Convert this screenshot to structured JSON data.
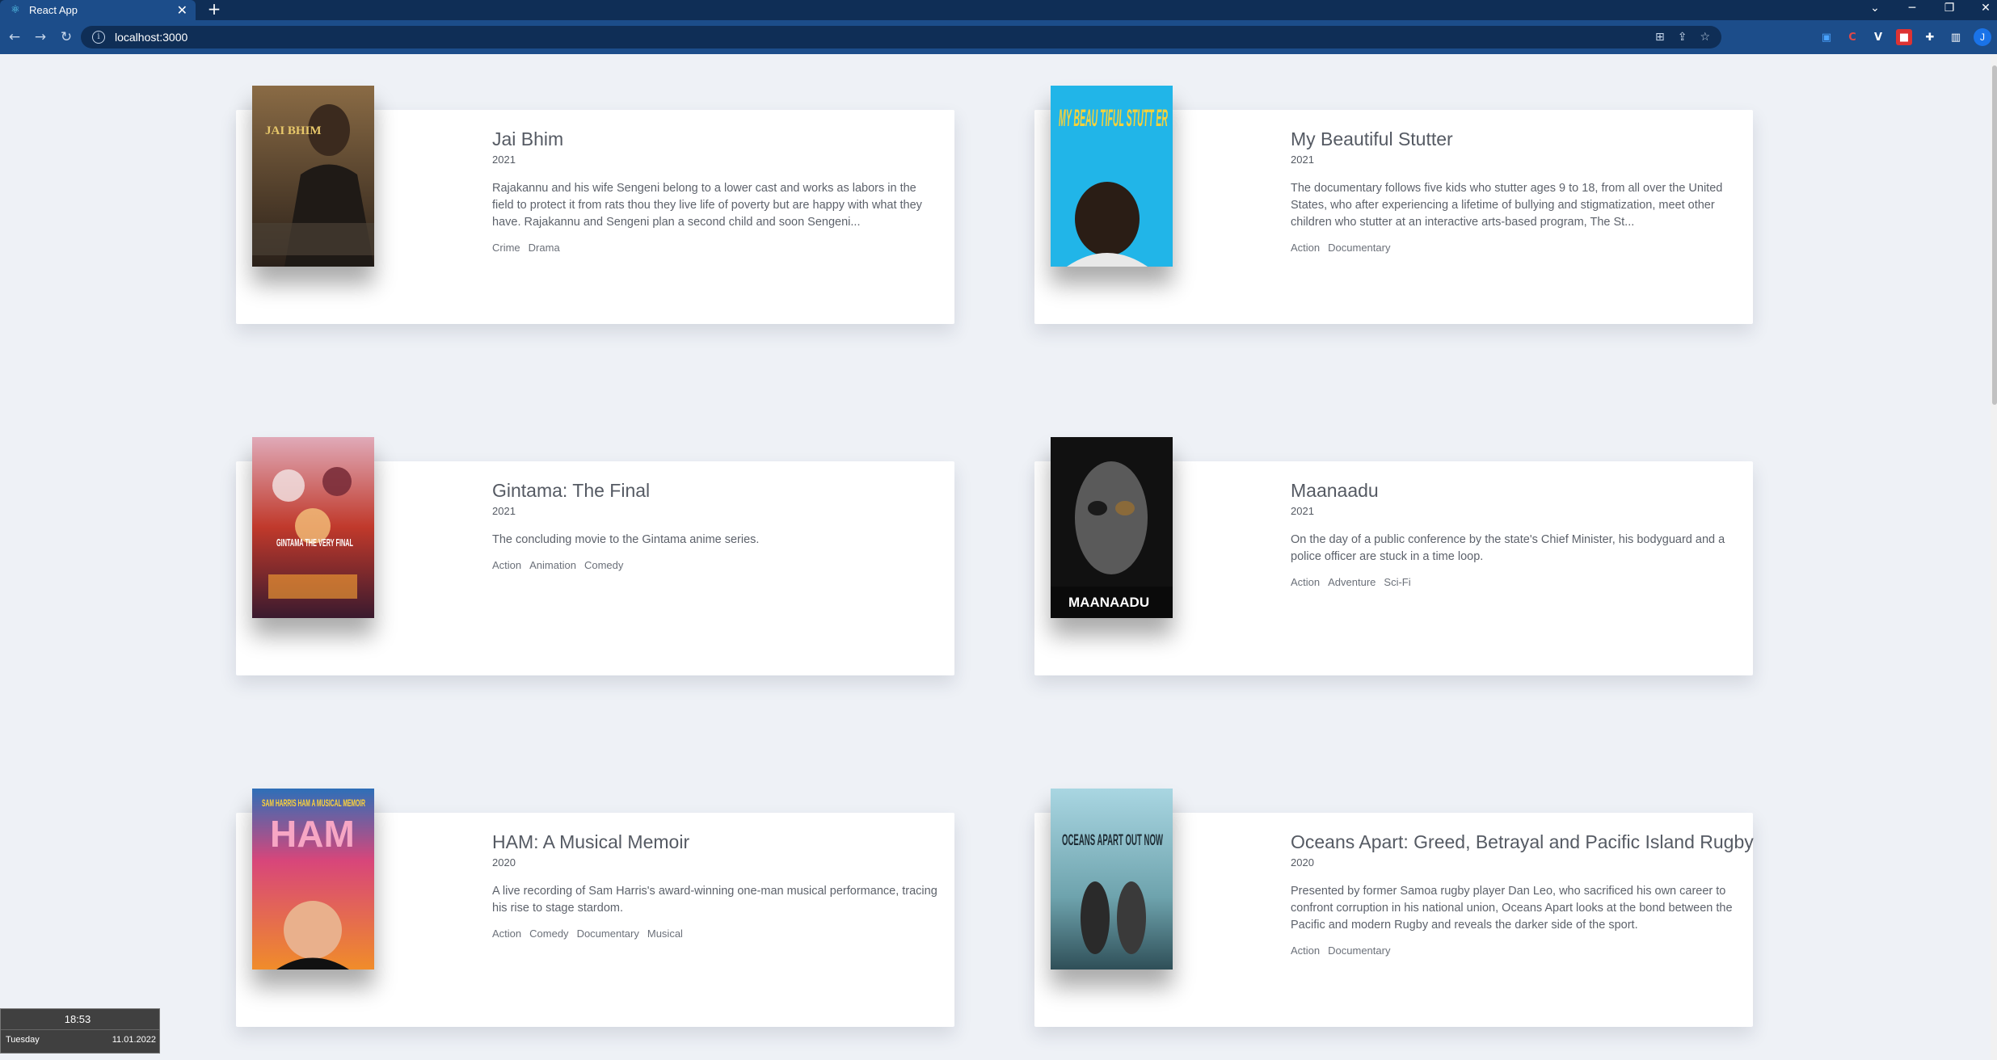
{
  "browser": {
    "tab_title": "React App",
    "tab_close": "✕",
    "new_tab": "+",
    "url": "localhost:3000",
    "profile_initial": "J",
    "window_controls": [
      "⌄",
      "─",
      "❐",
      "✕"
    ]
  },
  "movies": [
    {
      "title": "Jai Bhim",
      "year": "2021",
      "description": "Rajakannu and his wife Sengeni belong to a lower cast and works as labors in the field to protect it from rats thou they live life of poverty but are happy with what they have. Rajakannu and Sengeni plan a second child and soon Sengeni...",
      "genres": [
        "Crime",
        "Drama"
      ],
      "poster_text": "JAI BHIM",
      "poster_colors": [
        "#8a6b45",
        "#3b2d22"
      ]
    },
    {
      "title": "My Beautiful Stutter",
      "year": "2021",
      "description": "The documentary follows five kids who stutter ages 9 to 18, from all over the United States, who after experiencing a lifetime of bullying and stigmatization, meet other children who stutter at an interactive arts-based program, The St...",
      "genres": [
        "Action",
        "Documentary"
      ],
      "poster_text": "MY BEAU TIFUL STUTT ER",
      "poster_colors": [
        "#21b5e8",
        "#1692c4"
      ]
    },
    {
      "title": "Gintama: The Final",
      "year": "2021",
      "description": "The concluding movie to the Gintama anime series.",
      "genres": [
        "Action",
        "Animation",
        "Comedy"
      ],
      "poster_text": "GINTAMA THE VERY FINAL",
      "poster_colors": [
        "#c0392b",
        "#3a1a2e"
      ]
    },
    {
      "title": "Maanaadu",
      "year": "2021",
      "description": "On the day of a public conference by the state's Chief Minister, his bodyguard and a police officer are stuck in a time loop.",
      "genres": [
        "Action",
        "Adventure",
        "Sci-Fi"
      ],
      "poster_text": "MAANAADU",
      "poster_colors": [
        "#2b2b2b",
        "#0c0c0c"
      ]
    },
    {
      "title": "HAM: A Musical Memoir",
      "year": "2020",
      "description": "A live recording of Sam Harris's award-winning one-man musical performance, tracing his rise to stage stardom.",
      "genres": [
        "Action",
        "Comedy",
        "Documentary",
        "Musical"
      ],
      "poster_text": "SAM HARRIS HAM A MUSICAL MEMOIR",
      "poster_colors": [
        "#d8467a",
        "#f08c2a"
      ]
    },
    {
      "title": "Oceans Apart: Greed, Betrayal and Pacific Island Rugby",
      "year": "2020",
      "description": "Presented by former Samoa rugby player Dan Leo, who sacrificed his own career to confront corruption in his national union, Oceans Apart looks at the bond between the Pacific and modern Rugby and reveals the darker side of the sport.",
      "genres": [
        "Action",
        "Documentary"
      ],
      "poster_text": "OCEANS APART OUT NOW",
      "poster_colors": [
        "#7fb9c9",
        "#2f4f58"
      ]
    }
  ],
  "clock": {
    "time": "18:53",
    "day": "Tuesday",
    "date": "11.01.2022"
  }
}
